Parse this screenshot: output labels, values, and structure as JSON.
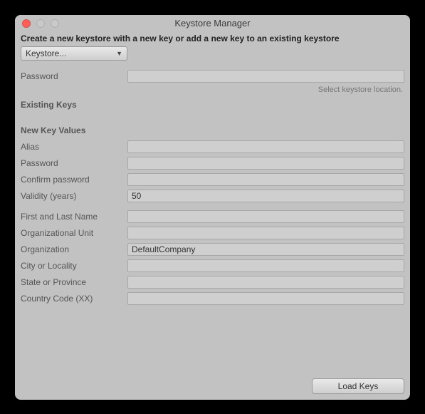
{
  "window": {
    "title": "Keystore Manager"
  },
  "instruction": "Create a new keystore with a new key or add a new key to an existing keystore",
  "dropdown": {
    "label": "Keystore..."
  },
  "password": {
    "label": "Password",
    "value": "",
    "hint": "Select keystore location."
  },
  "sections": {
    "existing": "Existing Keys",
    "newkey": "New Key Values"
  },
  "fields": {
    "alias": {
      "label": "Alias",
      "value": ""
    },
    "password2": {
      "label": "Password",
      "value": ""
    },
    "confirm": {
      "label": "Confirm password",
      "value": ""
    },
    "validity": {
      "label": "Validity (years)",
      "value": "50"
    },
    "name": {
      "label": "First and Last Name",
      "value": ""
    },
    "orgunit": {
      "label": "Organizational Unit",
      "value": ""
    },
    "org": {
      "label": "Organization",
      "value": "DefaultCompany"
    },
    "city": {
      "label": "City or Locality",
      "value": ""
    },
    "state": {
      "label": "State or Province",
      "value": ""
    },
    "country": {
      "label": "Country Code (XX)",
      "value": ""
    }
  },
  "footer": {
    "load": "Load Keys"
  }
}
